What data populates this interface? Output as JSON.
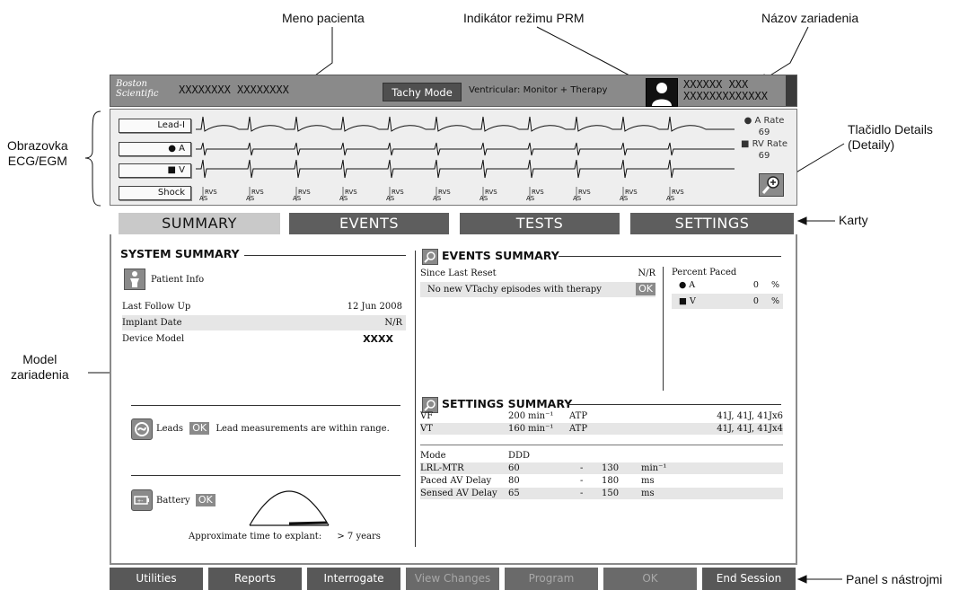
{
  "callouts": {
    "patient_name": "Meno pacienta",
    "prm_mode": "Indikátor režimu PRM",
    "device_name": "Názov zariadenia",
    "ecg_screen": "Obrazovka\nECG/EGM",
    "details_button": "Tlačidlo Details\n(Detaily)",
    "tabs": "Karty",
    "device_model": "Model\nzariadenia",
    "toolbar": "Panel s nástrojmi"
  },
  "topbar": {
    "logo": "Boston\nScientific",
    "patient_name": "XXXXXXXX XXXXXXXX",
    "mode_button": "Tachy Mode",
    "ventricular_mode": "Ventricular: Monitor + Therapy",
    "device_name_line1": "XXXXXX XXX",
    "device_name_line2": "XXXXXXXXXXXXX"
  },
  "ecg": {
    "leads": [
      "Lead-I",
      "● A",
      "■ V",
      "Shock"
    ],
    "a_rate_label": "● A Rate",
    "a_rate_value": "69",
    "rv_rate_label": "■ RV Rate",
    "rv_rate_value": "69",
    "markers": [
      "RVS",
      "RVS",
      "RVS",
      "RVS",
      "RVS",
      "RVS",
      "RVS",
      "RVS",
      "RVS",
      "RVS",
      "RVS"
    ],
    "marker_sub": "AS"
  },
  "tabs": [
    "SUMMARY",
    "EVENTS",
    "TESTS",
    "SETTINGS"
  ],
  "system_summary": {
    "title": "SYSTEM SUMMARY",
    "patient_info": "Patient Info",
    "rows": [
      {
        "label": "Last Follow Up",
        "value": "12 Jun 2008"
      },
      {
        "label": "Implant Date",
        "value": "N/R"
      },
      {
        "label": "Device Model",
        "value": "XXXX"
      }
    ],
    "leads_label": "Leads",
    "leads_ok": "OK",
    "leads_msg": "Lead measurements are within range.",
    "battery_label": "Battery",
    "battery_ok": "OK",
    "explant_label": "Approximate time to explant:",
    "explant_value": "> 7 years"
  },
  "events_summary": {
    "title": "EVENTS SUMMARY",
    "since_reset_label": "Since Last Reset",
    "since_reset_value": "N/R",
    "vtachy_msg": "No new VTachy episodes with therapy",
    "vtachy_ok": "OK",
    "percent_paced_title": "Percent Paced",
    "paced": [
      {
        "label": "● A",
        "value": "0",
        "unit": "%"
      },
      {
        "label": "■ V",
        "value": "0",
        "unit": "%"
      }
    ]
  },
  "settings_summary": {
    "title": "SETTINGS SUMMARY",
    "zones": [
      {
        "zone": "VF",
        "rate": "200",
        "unit": "min⁻¹",
        "therapy": "ATP",
        "shocks": "41J, 41J, 41Jx6"
      },
      {
        "zone": "VT",
        "rate": "160",
        "unit": "min⁻¹",
        "therapy": "ATP",
        "shocks": "41J, 41J, 41Jx4"
      }
    ],
    "brady": [
      {
        "label": "Mode",
        "v1": "DDD",
        "dash": "",
        "v2": "",
        "unit": ""
      },
      {
        "label": "LRL-MTR",
        "v1": "60",
        "dash": "-",
        "v2": "130",
        "unit": "min⁻¹"
      },
      {
        "label": "Paced AV Delay",
        "v1": "80",
        "dash": "-",
        "v2": "180",
        "unit": "ms"
      },
      {
        "label": "Sensed AV Delay",
        "v1": "65",
        "dash": "-",
        "v2": "150",
        "unit": "ms"
      }
    ]
  },
  "toolbar": {
    "buttons": [
      {
        "label": "Utilities",
        "enabled": true
      },
      {
        "label": "Reports",
        "enabled": true
      },
      {
        "label": "Interrogate",
        "enabled": true
      },
      {
        "label": "View Changes",
        "enabled": false
      },
      {
        "label": "Program",
        "enabled": false
      },
      {
        "label": "OK",
        "enabled": false
      },
      {
        "label": "End Session",
        "enabled": true
      }
    ]
  },
  "colors": {
    "bar_gray": "#8a8a8a",
    "tab_dark": "#5e5e5e",
    "tab_active": "#c9c9c9",
    "ok_badge": "#8a8a8a"
  }
}
